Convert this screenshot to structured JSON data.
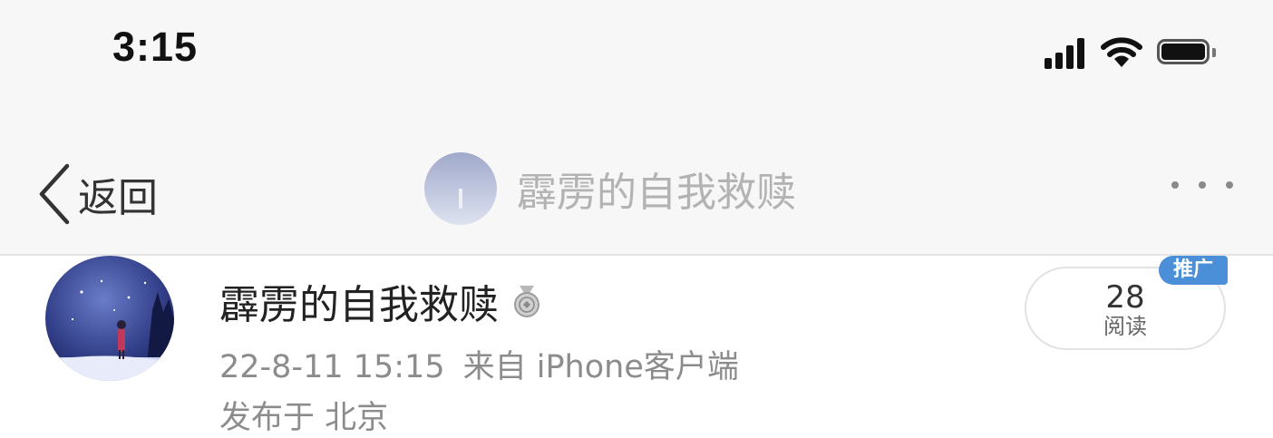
{
  "status_bar": {
    "time": "3:15",
    "icons": [
      "cellular-signal-icon",
      "wifi-icon",
      "battery-icon"
    ]
  },
  "nav": {
    "back_label": "返回",
    "title": "霹雳的自我救赎",
    "more_icon": "more-dots-icon"
  },
  "post": {
    "author_name": "霹雳的自我救赎",
    "medal_icon": "medal-icon",
    "date": "22-8-11 15:15",
    "source": "来自 iPhone客户端",
    "location": "发布于 北京",
    "read_count": "28",
    "read_label": "阅读",
    "promo_badge": "推广"
  },
  "colors": {
    "bar_background": "#f7f7f7",
    "primary_text": "#222222",
    "secondary_text": "#8c8c8c",
    "badge_blue": "#4a8fd8"
  }
}
